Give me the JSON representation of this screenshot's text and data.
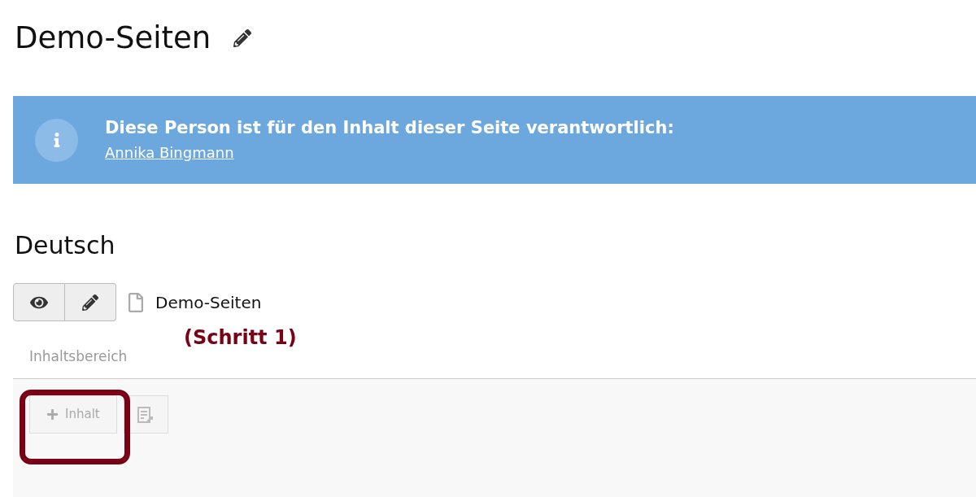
{
  "page_title": "Demo-Seiten",
  "info": {
    "message": "Diese Person ist für den Inhalt dieser Seite verantwortlich:",
    "link": "Annika Bingmann"
  },
  "language": "Deutsch",
  "page_entry": {
    "title": "Demo-Seiten"
  },
  "content_area": {
    "label": "Inhaltsbereich",
    "add_button": "Inhalt"
  },
  "annotation": {
    "label": "(Schritt 1)"
  }
}
